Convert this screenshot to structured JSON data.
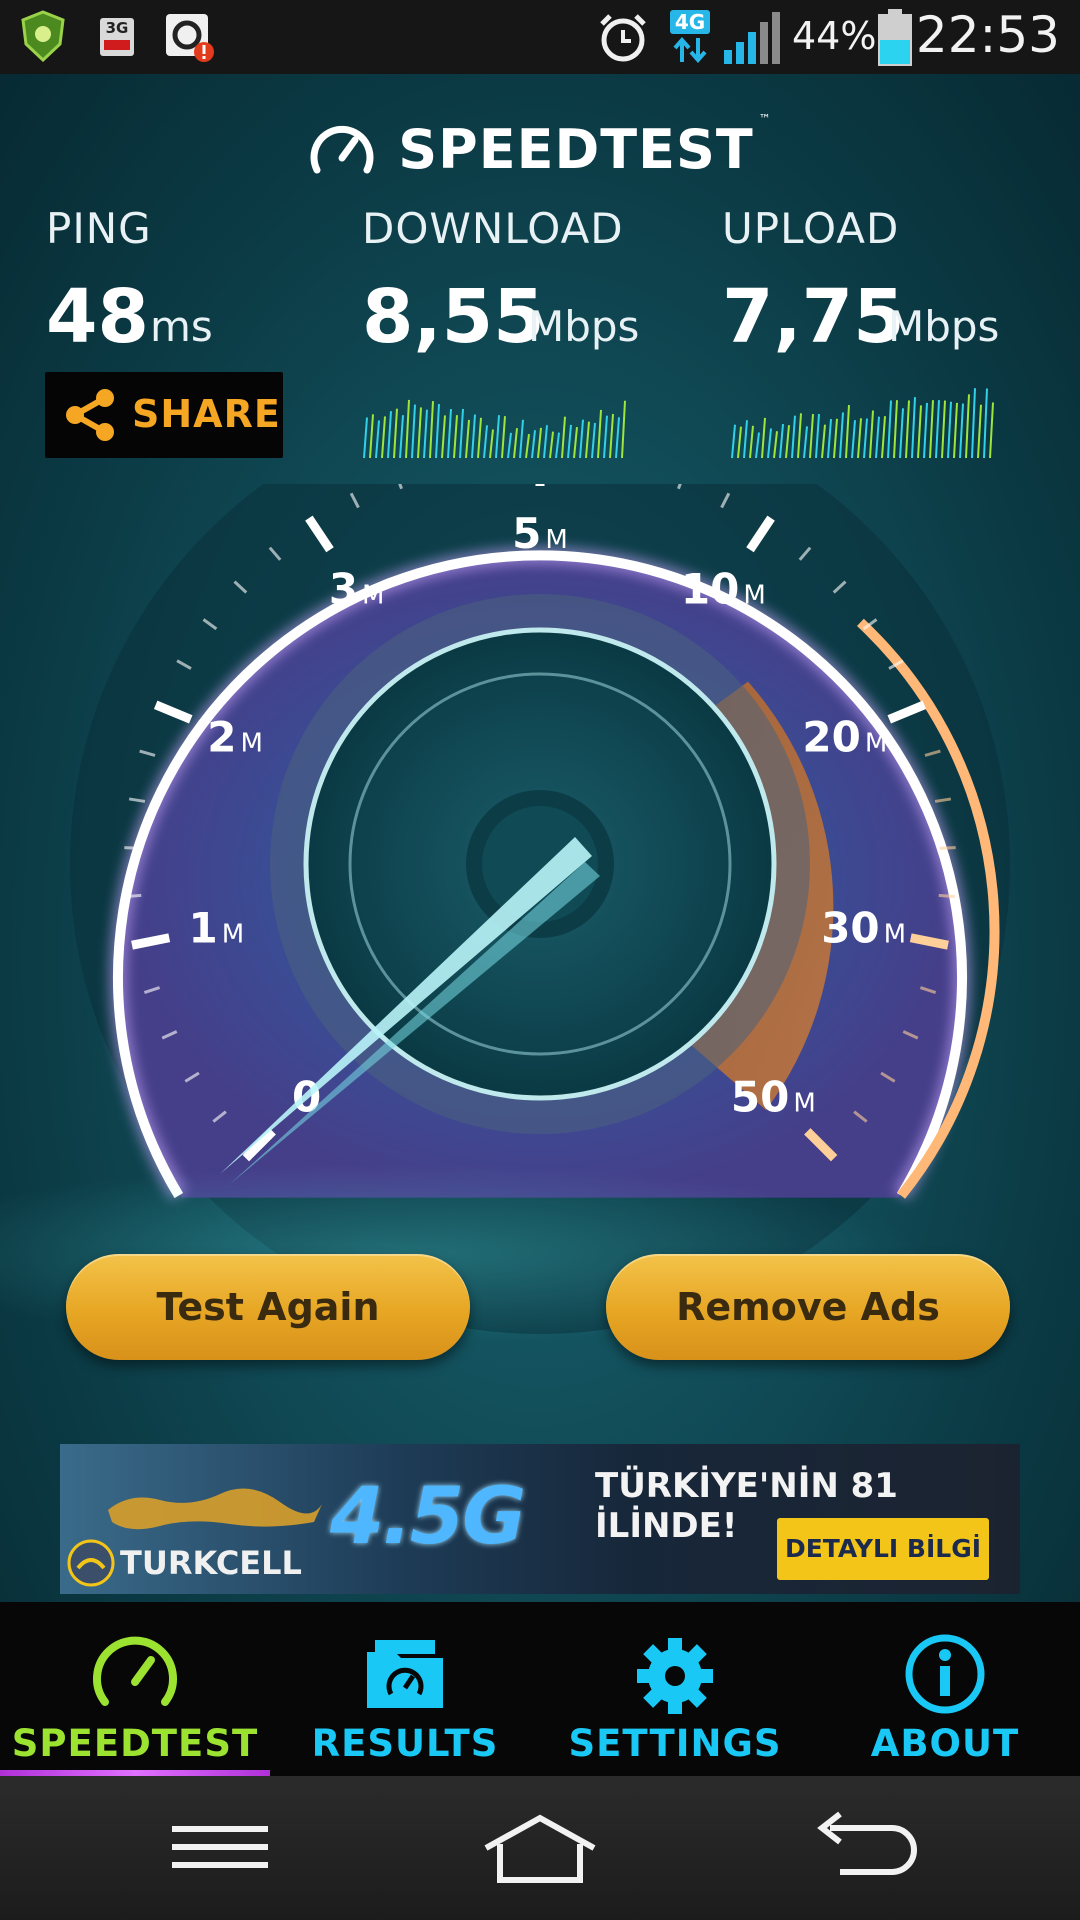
{
  "status_bar": {
    "network_badge": "3G",
    "data_badge": "4G",
    "battery_percent": "44%",
    "time": "22:53"
  },
  "app": {
    "brand": "SPEEDTEST",
    "trademark": "™"
  },
  "metrics": {
    "ping": {
      "label": "PING",
      "value": "48",
      "unit": "ms"
    },
    "download": {
      "label": "DOWNLOAD",
      "value": "8,55",
      "unit": "Mbps"
    },
    "upload": {
      "label": "UPLOAD",
      "value": "7,75",
      "unit": "Mbps"
    }
  },
  "share": {
    "label": "SHARE"
  },
  "gauge": {
    "ticks": [
      {
        "num": "0",
        "unit": ""
      },
      {
        "num": "1",
        "unit": "M"
      },
      {
        "num": "2",
        "unit": "M"
      },
      {
        "num": "3",
        "unit": "M"
      },
      {
        "num": "5",
        "unit": "M"
      },
      {
        "num": "10",
        "unit": "M"
      },
      {
        "num": "20",
        "unit": "M"
      },
      {
        "num": "30",
        "unit": "M"
      },
      {
        "num": "50",
        "unit": "M"
      }
    ]
  },
  "actions": {
    "test_again": "Test Again",
    "remove_ads": "Remove Ads"
  },
  "ad": {
    "product": "4.5G",
    "headline": "TÜRKİYE'NİN 81 İLİNDE!",
    "cta": "DETAYLI BİLGİ",
    "brand": "TURKCELL"
  },
  "nav": {
    "tabs": [
      {
        "label": "SPEEDTEST",
        "icon": "speedometer-icon",
        "active": true
      },
      {
        "label": "RESULTS",
        "icon": "results-folder-icon",
        "active": false
      },
      {
        "label": "SETTINGS",
        "icon": "gear-icon",
        "active": false
      },
      {
        "label": "ABOUT",
        "icon": "info-icon",
        "active": false
      }
    ]
  },
  "colors": {
    "accent_orange": "#f5a623",
    "active_tab": "#9be330",
    "inactive_tab": "#19c8f5",
    "button_gold": "#e7a624"
  }
}
